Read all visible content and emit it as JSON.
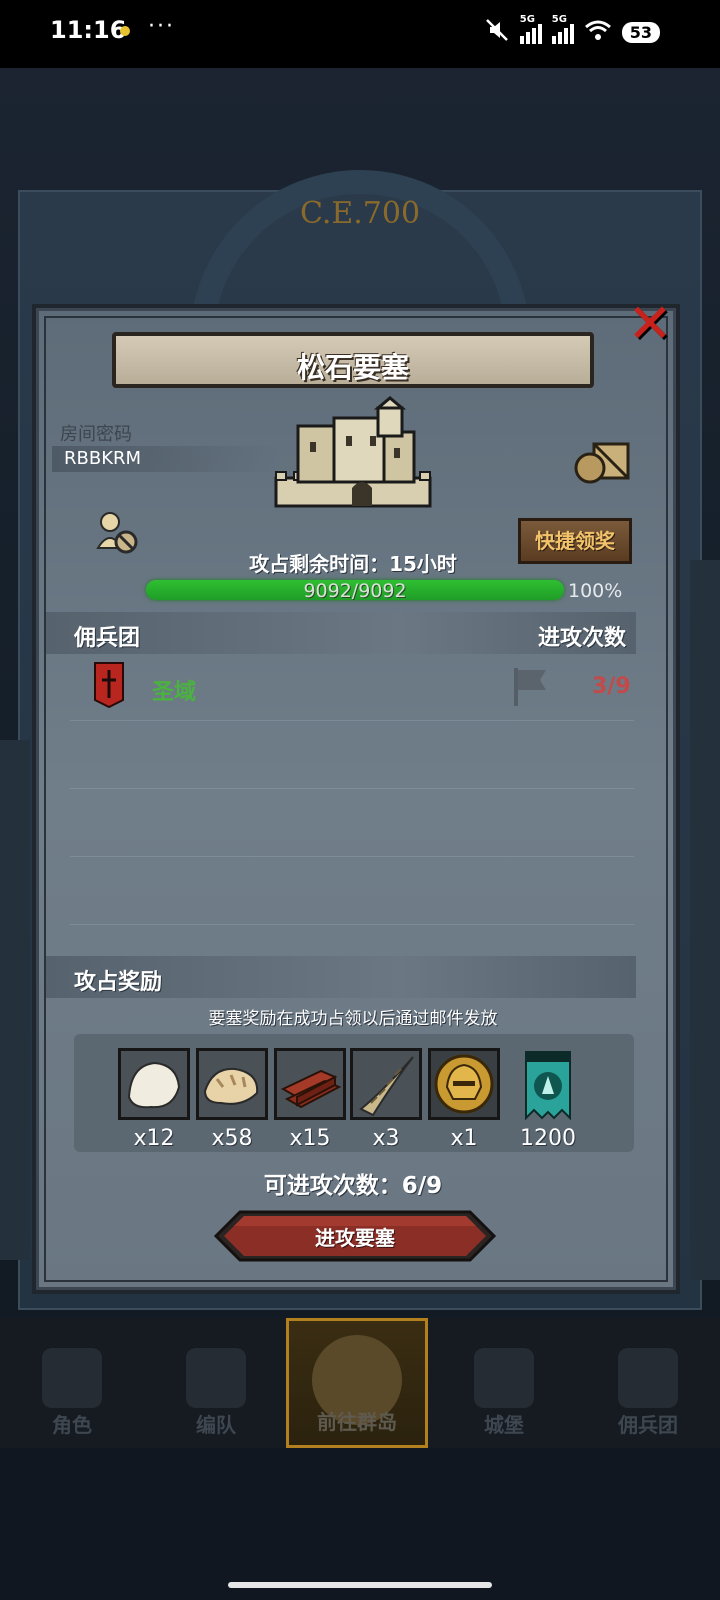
{
  "status_bar": {
    "time": "11:16",
    "more": "···",
    "battery": "53",
    "signal_label": "5G"
  },
  "background": {
    "era_label": "C.E.700"
  },
  "dialog": {
    "title": "松石要塞",
    "room_label": "房间密码",
    "room_code": "RBBKRM",
    "quick_claim_label": "快捷领奖",
    "time_left": "攻占剩余时间：15小时",
    "hp_text": "9092/9092",
    "hp_percent": "100%",
    "hp_fraction": 1.0,
    "guild_header": "佣兵团",
    "attacks_header": "进攻次数",
    "guild_row": {
      "name": "圣域",
      "attacks": "3/9"
    },
    "rewards_header": "攻占奖励",
    "rewards_note": "要塞奖励在成功占领以后通过邮件发放",
    "rewards": [
      {
        "icon": "white-fur-icon",
        "qty": "x12"
      },
      {
        "icon": "tan-fur-icon",
        "qty": "x58"
      },
      {
        "icon": "wood-planks-icon",
        "qty": "x15"
      },
      {
        "icon": "horn-icon",
        "qty": "x3"
      },
      {
        "icon": "gold-helmet-icon",
        "qty": "x1"
      },
      {
        "icon": "teal-banner-icon",
        "qty": "1200"
      }
    ],
    "remaining_attacks": "可进攻次数：6/9",
    "attack_button": "进攻要塞"
  },
  "nav": {
    "items": [
      {
        "label": "角色",
        "icon": "character-icon"
      },
      {
        "label": "编队",
        "icon": "formation-icon"
      },
      {
        "label": "前往群岛",
        "icon": "islands-icon",
        "active": true
      },
      {
        "label": "城堡",
        "icon": "castle-icon"
      },
      {
        "label": "佣兵团",
        "icon": "mercenary-icon"
      }
    ]
  },
  "colors": {
    "hp_green": "#2fbf32",
    "guild_green": "#4ab23f",
    "count_red": "#c24a4a",
    "close_red": "#c7221b",
    "quick_gold": "#f2c36a"
  }
}
